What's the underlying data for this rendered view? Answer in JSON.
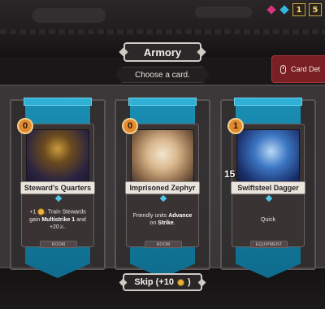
{
  "header": {
    "title": "Armory",
    "subtitle": "Choose a card.",
    "card_details_label": "Card Det"
  },
  "resources": {
    "icons": [
      "pink-crystal-icon",
      "cyan-crystal-icon"
    ],
    "box1": "1",
    "box2": "5"
  },
  "cards": [
    {
      "name": "Steward's Quarters",
      "cost": "0",
      "text_line1": "+1 ",
      "text_line1b": ". Train Stewards",
      "text_line2_pre": "gain ",
      "text_line2_bold": "Multistrike 1",
      "text_line2_post": " and",
      "text_line3": "+20",
      "text_line3_post": ".",
      "type": "ROOM",
      "art": "dungeon-room-art",
      "ribbon_color": "#1b8fb4"
    },
    {
      "name": "Imprisoned Zephyr",
      "cost": "0",
      "text_line1_pre": "Friendly units ",
      "text_line1_bold": "Advance",
      "text_line2_pre": "on ",
      "text_line2_bold": "Strike",
      "text_line2_post": ".",
      "type": "ROOM",
      "art": "wind-vortex-art",
      "ribbon_color": "#1b8fb4"
    },
    {
      "name": "Swiftsteel Dagger",
      "cost": "1",
      "attack": "15",
      "text_line1": "Quick",
      "type": "EQUIPMENT",
      "art": "lightning-dagger-art",
      "ribbon_color": "#1b8fb4"
    }
  ],
  "skip": {
    "label_pre": "Skip (+10",
    "label_post": ")"
  },
  "colors": {
    "accent_blue": "#1b8fb4",
    "cost_orange": "#e28a2f",
    "details_red": "#7a1f24"
  }
}
